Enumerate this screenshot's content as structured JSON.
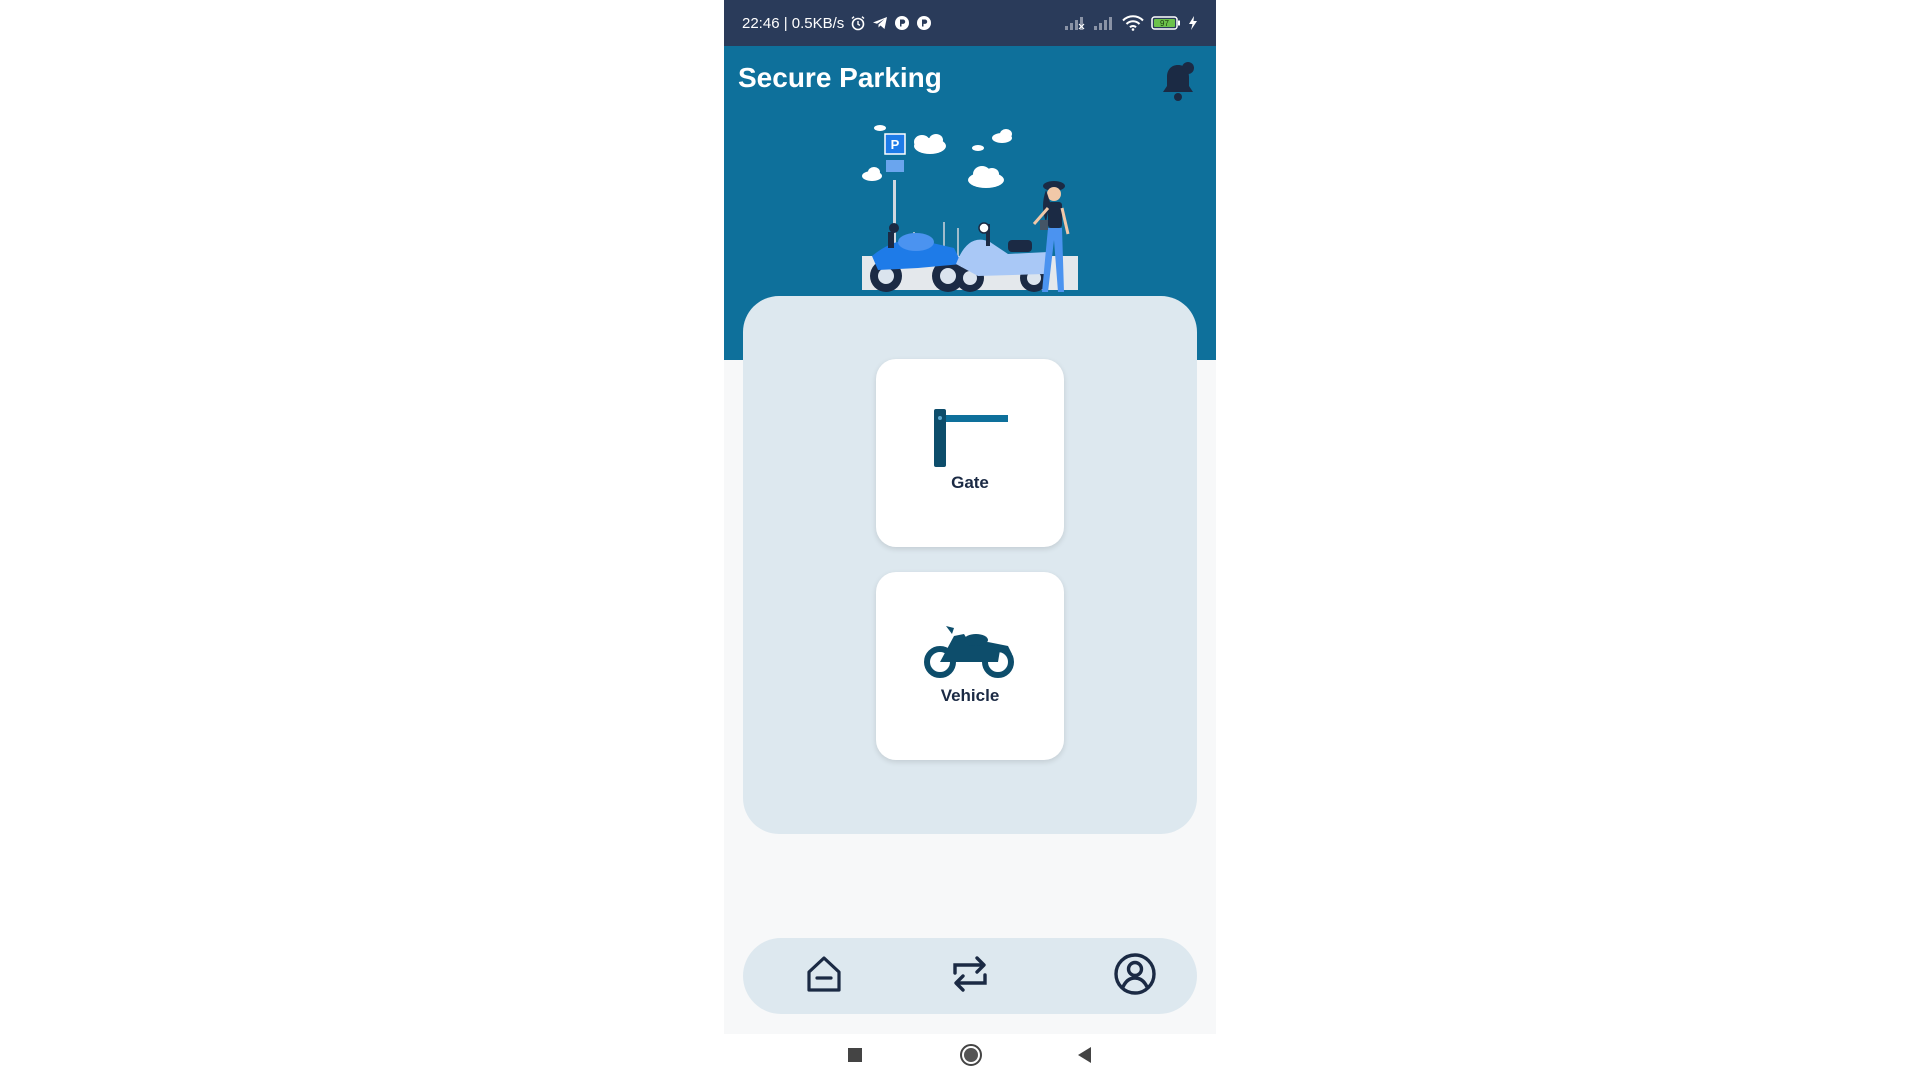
{
  "status_bar": {
    "time_speed": "22:46 | 0.5KB/s",
    "battery_level": "97",
    "icons": [
      "alarm-icon",
      "telegram-icon",
      "app-icon",
      "app-icon",
      "signal-icon",
      "signal-icon",
      "wifi-icon",
      "battery-icon",
      "charging-icon"
    ]
  },
  "header": {
    "title": "Secure Parking",
    "bell_icon": "notification-bell-icon",
    "background_color": "#0e709b"
  },
  "tiles": [
    {
      "label": "Gate",
      "icon": "gate-barrier-icon"
    },
    {
      "label": "Vehicle",
      "icon": "motorcycle-icon"
    }
  ],
  "bottom_nav": {
    "items": [
      {
        "icon": "home-icon"
      },
      {
        "icon": "swap-icon"
      },
      {
        "icon": "profile-icon"
      }
    ]
  },
  "system_nav": {
    "items": [
      "recents-icon",
      "home-circle-icon",
      "back-icon"
    ]
  },
  "colors": {
    "status_bar": "#2a3b5a",
    "accent": "#0e709b",
    "card_background": "#dde8ef",
    "text_dark": "#1b2a44",
    "icon_dark": "#0d4d6b"
  }
}
